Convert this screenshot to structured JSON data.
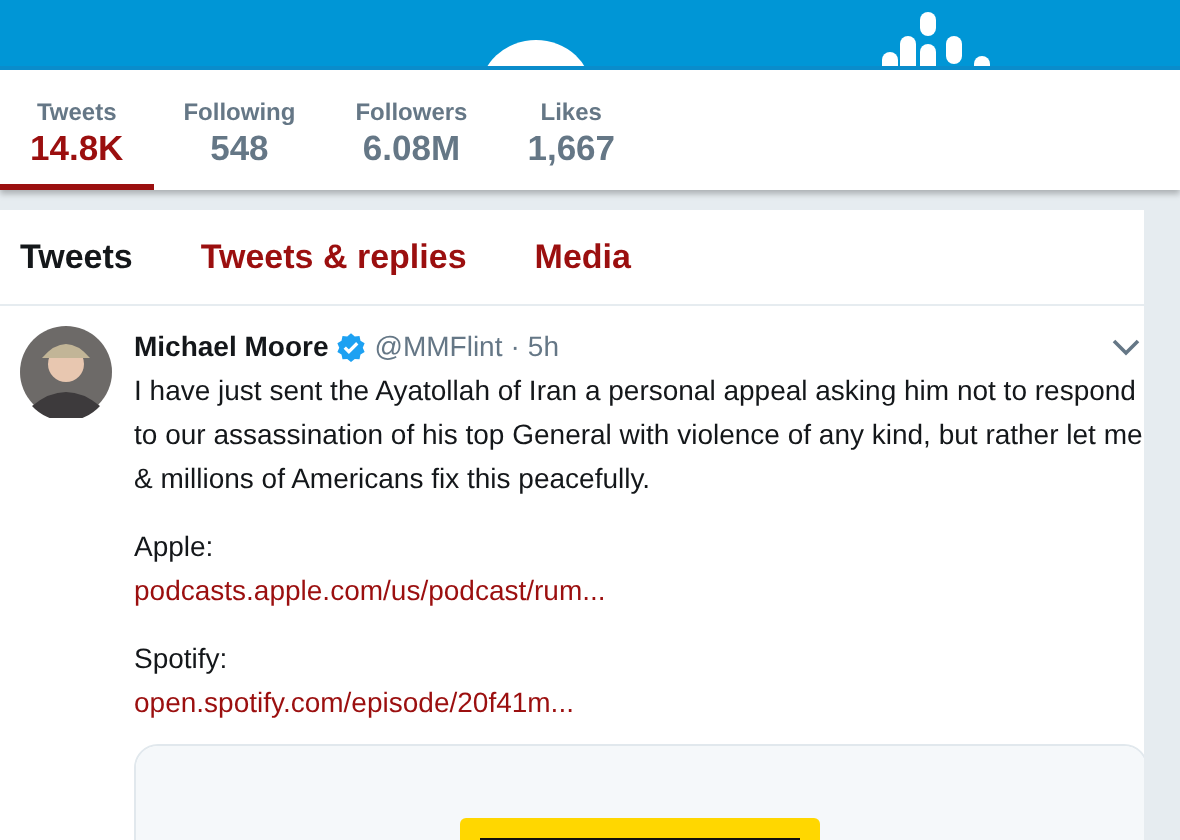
{
  "profile_nav": [
    {
      "label": "Tweets",
      "value": "14.8K",
      "selected": true
    },
    {
      "label": "Following",
      "value": "548",
      "selected": false
    },
    {
      "label": "Followers",
      "value": "6.08M",
      "selected": false
    },
    {
      "label": "Likes",
      "value": "1,667",
      "selected": false
    }
  ],
  "timeline_tabs": [
    {
      "label": "Tweets",
      "selected": true
    },
    {
      "label": "Tweets & replies",
      "selected": false
    },
    {
      "label": "Media",
      "selected": false
    }
  ],
  "tweet": {
    "name": "Michael Moore",
    "verified": true,
    "handle": "@MMFlint",
    "separator": "·",
    "time": "5h",
    "blocks": [
      {
        "lines": [
          {
            "kind": "text",
            "text": "I have just sent the Ayatollah of Iran a personal appeal asking him not to respond to our assassination of his top General with violence of any kind, but rather let me & millions of Americans fix this peacefully."
          }
        ]
      },
      {
        "lines": [
          {
            "kind": "text",
            "text": "Apple:"
          },
          {
            "kind": "link",
            "text": "podcasts.apple.com/us/podcast/rum..."
          }
        ]
      },
      {
        "lines": [
          {
            "kind": "text",
            "text": "Spotify:"
          },
          {
            "kind": "link",
            "text": "open.spotify.com/episode/20f41m..."
          }
        ]
      }
    ]
  }
}
